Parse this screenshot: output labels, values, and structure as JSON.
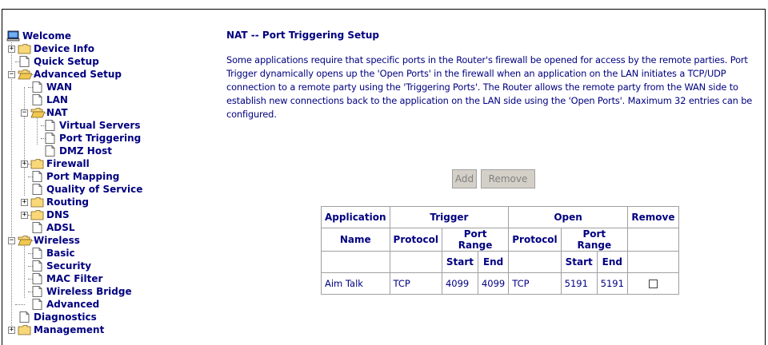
{
  "sidebar": {
    "welcome": "Welcome",
    "device_info": "Device Info",
    "quick_setup": "Quick Setup",
    "advanced_setup": "Advanced Setup",
    "wan": "WAN",
    "lan": "LAN",
    "nat": "NAT",
    "virtual_servers": "Virtual Servers",
    "port_triggering": "Port Triggering",
    "dmz_host": "DMZ Host",
    "firewall": "Firewall",
    "port_mapping": "Port Mapping",
    "quality_of_service": "Quality of Service",
    "routing": "Routing",
    "dns": "DNS",
    "adsl": "ADSL",
    "wireless": "Wireless",
    "basic": "Basic",
    "security": "Security",
    "mac_filter": "MAC Filter",
    "wireless_bridge": "Wireless Bridge",
    "advanced": "Advanced",
    "diagnostics": "Diagnostics",
    "management": "Management"
  },
  "main": {
    "title": "NAT -- Port Triggering Setup",
    "description": "Some applications require that specific ports in the Router's firewall be opened for access by the remote parties. Port Trigger dynamically opens up the 'Open Ports' in the firewall when an application on the LAN initiates a TCP/UDP connection to a remote party using the 'Triggering Ports'. The Router allows the remote party from the WAN side to establish new connections back to the application on the LAN side using the 'Open Ports'. Maximum 32 entries can be configured.",
    "add_label": "Add",
    "remove_label": "Remove"
  },
  "table": {
    "h_application": "Application",
    "h_trigger": "Trigger",
    "h_open": "Open",
    "h_remove": "Remove",
    "h_name": "Name",
    "h_protocol": "Protocol",
    "h_port_range": "Port Range",
    "h_protocol2": "Protocol",
    "h_port_range2": "Port Range",
    "h_start": "Start",
    "h_end": "End",
    "h_start2": "Start",
    "h_end2": "End",
    "rows": [
      {
        "name": "Aim Talk",
        "trigger_protocol": "TCP",
        "trigger_start": "4099",
        "trigger_end": "4099",
        "open_protocol": "TCP",
        "open_start": "5191",
        "open_end": "5191",
        "remove_checked": false
      }
    ]
  },
  "colors": {
    "text": "#000080",
    "button_bg": "#d4d0c8",
    "button_text": "#808080",
    "folder": "#f8d878"
  }
}
